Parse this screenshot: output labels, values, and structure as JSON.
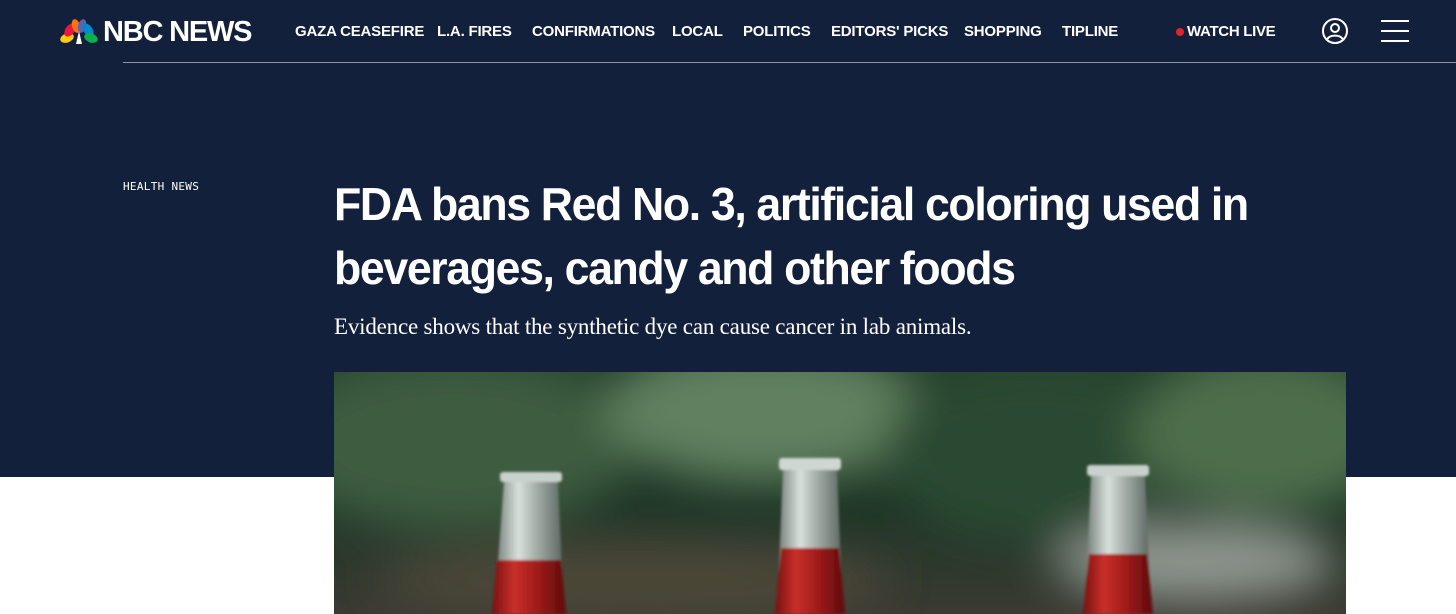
{
  "header": {
    "brand": "NBC NEWS",
    "nav_items": [
      {
        "label": "GAZA CEASEFIRE"
      },
      {
        "label": "L.A. FIRES"
      },
      {
        "label": "CONFIRMATIONS"
      },
      {
        "label": "LOCAL"
      },
      {
        "label": "POLITICS"
      },
      {
        "label": "EDITORS' PICKS"
      },
      {
        "label": "SHOPPING"
      },
      {
        "label": "TIPLINE"
      }
    ],
    "watch_live": "WATCH LIVE",
    "icons": {
      "user": "user-icon",
      "menu": "hamburger-menu-icon",
      "logo": "peacock-logo-icon"
    }
  },
  "article": {
    "eyebrow": "HEALTH NEWS",
    "headline": "FDA bans Red No. 3, artificial coloring used in beverages, candy and other foods",
    "dek": "Evidence shows that the synthetic dye can cause cancer in lab animals."
  },
  "colors": {
    "hero_background": "#13203b",
    "live_dot": "#e1262b",
    "text": "#ffffff"
  }
}
